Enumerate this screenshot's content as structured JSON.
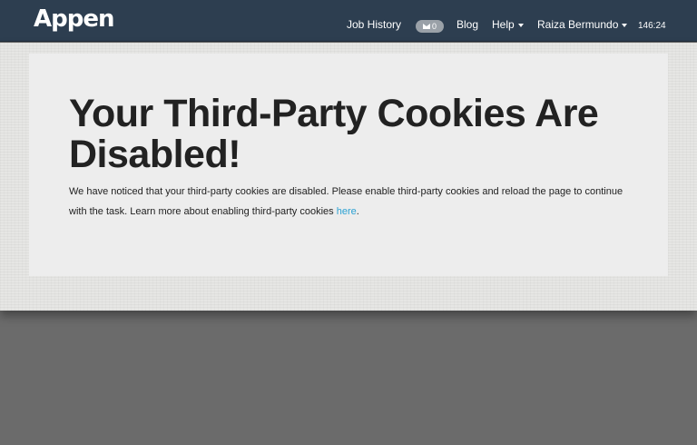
{
  "navbar": {
    "brand": "Appen",
    "job_history": "Job History",
    "messages_count": "0",
    "blog": "Blog",
    "help": "Help",
    "user": "Raiza Bermundo",
    "timer": "146:24"
  },
  "notice": {
    "title": "Your Third-Party Cookies Are Disabled!",
    "body": "We have noticed that your third-party cookies are disabled. Please enable third-party cookies and reload the page to continue with the task. Learn more about enabling third-party cookies ",
    "link_text": "here",
    "period": "."
  },
  "colors": {
    "navbar_bg": "#2d3e50",
    "link": "#2aa1d3"
  }
}
